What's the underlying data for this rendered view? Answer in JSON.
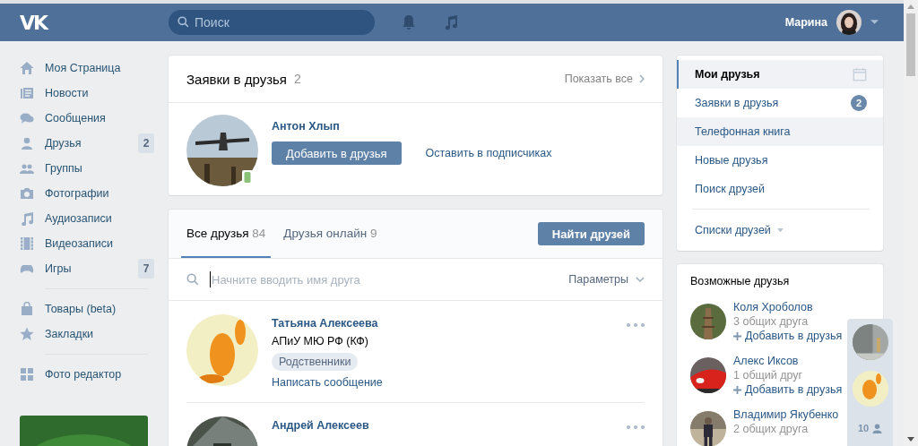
{
  "header": {
    "logo": "VK",
    "search": {
      "placeholder": "Поиск"
    },
    "user_name": "Марина"
  },
  "nav": {
    "groups": [
      [
        {
          "label": "Моя Страница"
        },
        {
          "label": "Новости"
        },
        {
          "label": "Сообщения"
        },
        {
          "label": "Друзья",
          "count": "2"
        },
        {
          "label": "Группы"
        },
        {
          "label": "Фотографии"
        },
        {
          "label": "Аудиозаписи"
        },
        {
          "label": "Видеозаписи"
        },
        {
          "label": "Игры",
          "count": "7"
        }
      ],
      [
        {
          "label": "Товары (beta)"
        },
        {
          "label": "Закладки"
        }
      ],
      [
        {
          "label": "Фото редактор"
        }
      ]
    ]
  },
  "requests": {
    "title": "Заявки в друзья",
    "count": "2",
    "show_all": "Показать все",
    "items": [
      {
        "name": "Антон Хлып",
        "add_button": "Добавить в друзья",
        "keep_link": "Оставить в подписчиках",
        "mobile": true
      }
    ]
  },
  "friends": {
    "tabs": [
      {
        "label": "Все друзья",
        "count": "84",
        "selected": true
      },
      {
        "label": "Друзья онлайн",
        "count": "9",
        "selected": false
      }
    ],
    "find_button": "Найти друзей",
    "search": {
      "placeholder": "Начните вводить имя друга"
    },
    "params": "Параметры",
    "items": [
      {
        "name": "Татьяна Алексеева",
        "subtitle": "АПиУ МЮ РФ (КФ)",
        "tag": "Родственники",
        "message_link": "Написать сообщение"
      },
      {
        "name": "Андрей Алексеев"
      }
    ]
  },
  "menu": {
    "items": [
      {
        "label": "Мои друзья",
        "selected": true,
        "hovered": false,
        "kind": "calendar"
      },
      {
        "label": "Заявки в друзья",
        "selected": false,
        "hovered": false,
        "badge": "2"
      },
      {
        "label": "Телефонная книга",
        "selected": false,
        "hovered": true
      },
      {
        "label": "Новые друзья",
        "selected": false,
        "hovered": false
      },
      {
        "label": "Поиск друзей",
        "selected": false,
        "hovered": false
      }
    ],
    "lists": "Списки друзей"
  },
  "suggestions": {
    "title": "Возможные друзья",
    "items": [
      {
        "name": "Коля Хроболов",
        "mutual": "3 общих друга",
        "add": "Добавить в друзья"
      },
      {
        "name": "Алекс Иксов",
        "mutual": "1 общий друг",
        "add": "Добавить в друзья"
      },
      {
        "name": "Владимир Якубенко",
        "mutual": "2 общих друга"
      }
    ]
  },
  "online": {
    "count": "10"
  }
}
